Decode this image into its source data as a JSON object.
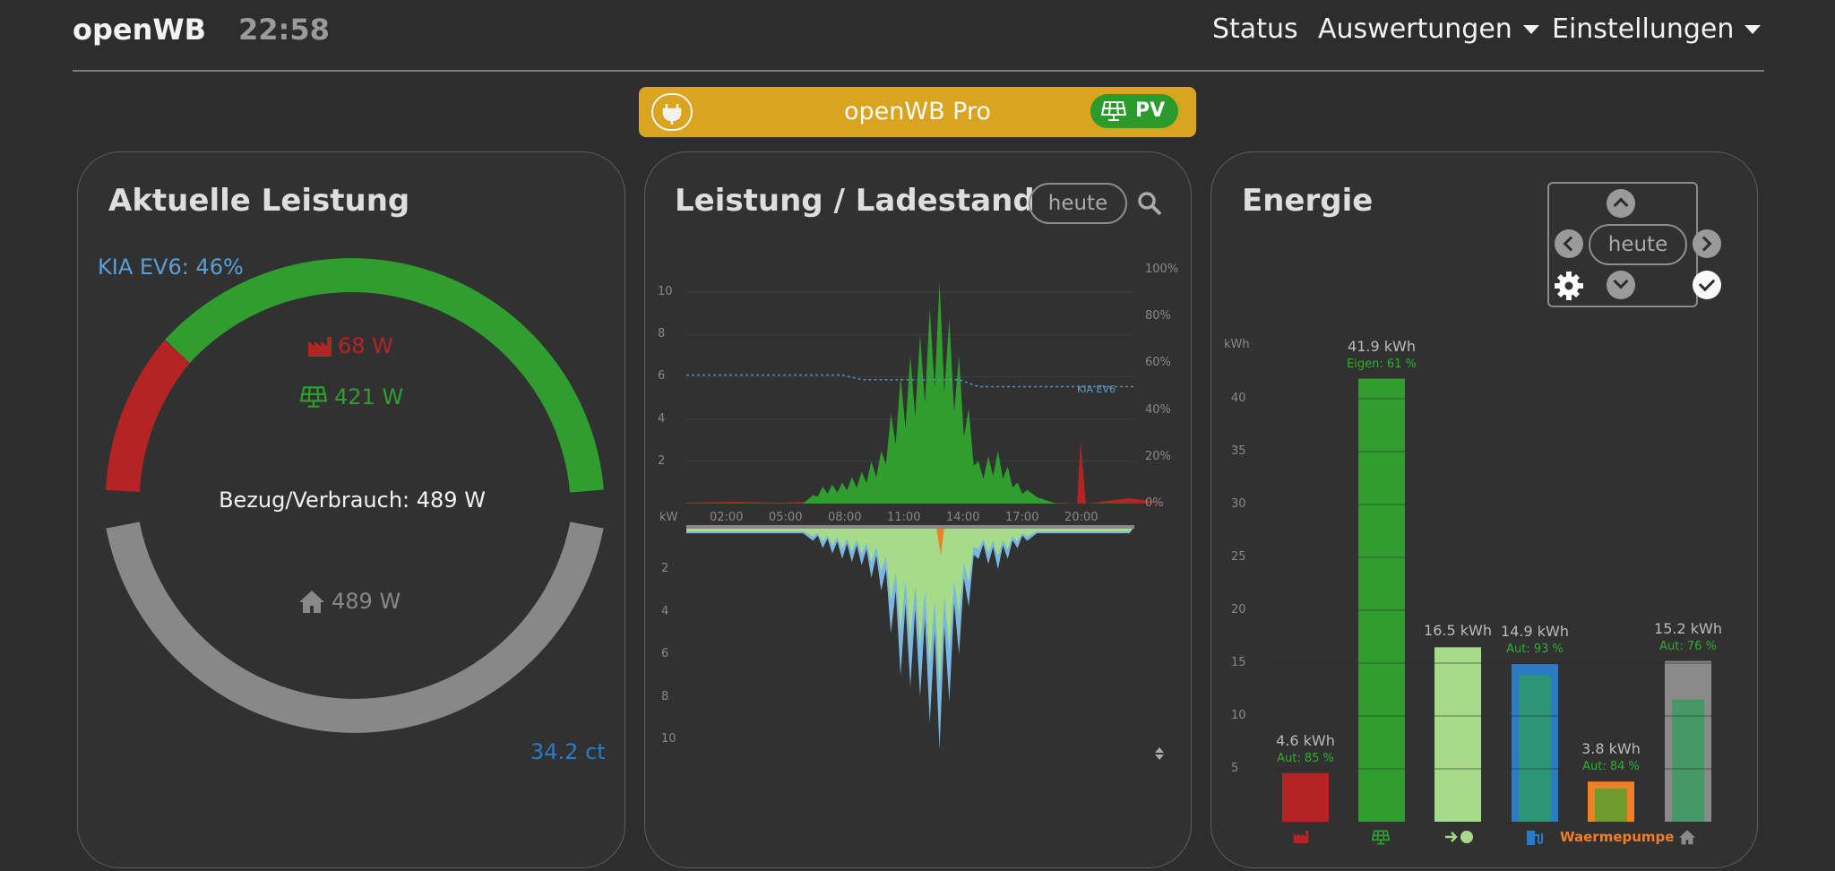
{
  "header": {
    "brand": "openWB",
    "clock": "22:58",
    "nav": {
      "status": "Status",
      "auswertungen": "Auswertungen",
      "einstellungen": "Einstellungen"
    }
  },
  "banner": {
    "title": "openWB Pro",
    "badge": "PV",
    "color": "#d9a420"
  },
  "power_card": {
    "title": "Aktuelle Leistung",
    "vehicle_soc": "KIA EV6: 46%",
    "grid": "68 W",
    "pv": "421 W",
    "center": "Bezug/Verbrauch: 489 W",
    "home": "489 W",
    "price": "34.2 ct",
    "colors": {
      "pv": "#2f9e2f",
      "grid": "#b52424",
      "home": "#888888",
      "vehicle": "#5a9fd4"
    }
  },
  "chart_card": {
    "title": "Leistung / Ladestand",
    "period": "heute",
    "vehicle_label": "KIA EV6",
    "unit_label": "kW",
    "y_ticks_top": [
      "10",
      "8",
      "6",
      "4",
      "2"
    ],
    "y_ticks_bottom": [
      "2",
      "4",
      "6",
      "8",
      "10"
    ],
    "soc_ticks": [
      "100%",
      "80%",
      "60%",
      "40%",
      "20%",
      "0%"
    ],
    "x_ticks": [
      "02:00",
      "05:00",
      "08:00",
      "11:00",
      "14:00",
      "17:00",
      "20:00"
    ]
  },
  "energy_card": {
    "title": "Energie",
    "period": "heute",
    "unit": "kWh",
    "y_ticks": [
      "40",
      "35",
      "30",
      "25",
      "20",
      "15",
      "10",
      "5"
    ],
    "bars": [
      {
        "value": "4.6 kWh",
        "sub": "Aut: 85 %",
        "icon": "factory-icon",
        "color": "#b52424"
      },
      {
        "value": "41.9 kWh",
        "sub": "Eigen: 61 %",
        "icon": "solar-panel-icon",
        "color": "#2f9e2f"
      },
      {
        "value": "16.5 kWh",
        "sub": "",
        "icon": "export-icon",
        "color": "#a6db8a"
      },
      {
        "value": "14.9 kWh",
        "sub": "Aut: 93 %",
        "icon": "charging-station-icon",
        "color": "#2b7bc4"
      },
      {
        "value": "3.8 kWh",
        "sub": "Aut: 84 %",
        "label": "Waermepumpe",
        "color": "#f07f2a"
      },
      {
        "value": "15.2 kWh",
        "sub": "Aut: 76 %",
        "icon": "home-icon",
        "color": "#8a8a8a"
      }
    ]
  },
  "chart_data": [
    {
      "type": "area",
      "title": "Leistung / Ladestand",
      "x": [
        "00:00",
        "01:00",
        "02:00",
        "03:00",
        "04:00",
        "05:00",
        "06:00",
        "07:00",
        "08:00",
        "09:00",
        "10:00",
        "11:00",
        "12:00",
        "13:00",
        "14:00",
        "15:00",
        "16:00",
        "17:00",
        "18:00",
        "19:00",
        "20:00",
        "21:00",
        "22:00",
        "23:00"
      ],
      "series": [
        {
          "name": "PV",
          "values": [
            0,
            0,
            0,
            0,
            0,
            0,
            0,
            0.8,
            1.0,
            1.5,
            2.5,
            6.0,
            8.0,
            10.5,
            7.0,
            2.0,
            2.5,
            1.0,
            0.3,
            0,
            0,
            0,
            0,
            0
          ]
        },
        {
          "name": "KIA EV6",
          "values": [
            55,
            55,
            55,
            55,
            55,
            55,
            55,
            55,
            55,
            53,
            53,
            53,
            53,
            53,
            53,
            50,
            50,
            50,
            50,
            50,
            50,
            50,
            50,
            50
          ],
          "unit": "%"
        },
        {
          "name": "Verbrauch",
          "values": [
            -0.3,
            -0.3,
            -0.3,
            -0.3,
            -0.3,
            -0.3,
            -0.3,
            -1.0,
            -1.5,
            -1.8,
            -3.0,
            -7.0,
            -8.0,
            -10.5,
            -6.0,
            -1.5,
            -2.0,
            -1.0,
            -0.3,
            -0.3,
            -0.3,
            -0.3,
            -0.3,
            -0.3
          ]
        }
      ],
      "ylim": [
        -10,
        10
      ]
    },
    {
      "type": "bar",
      "title": "Energie",
      "categories": [
        "Bezug",
        "PV",
        "Export",
        "Laden",
        "Waermepumpe",
        "Haus"
      ],
      "values": [
        4.6,
        41.9,
        16.5,
        14.9,
        3.8,
        15.2
      ],
      "ylabel": "kWh",
      "ylim": [
        0,
        45
      ]
    }
  ]
}
